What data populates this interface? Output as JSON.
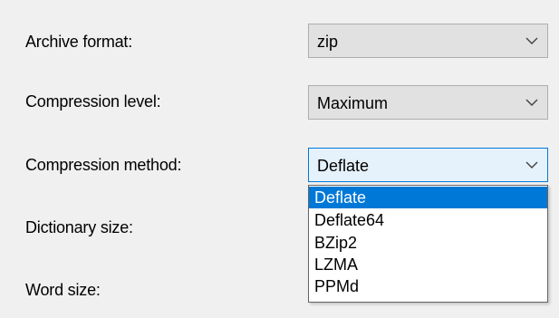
{
  "fields": [
    {
      "label": "Archive format:",
      "value": "zip"
    },
    {
      "label": "Compression level:",
      "value": "Maximum"
    },
    {
      "label": "Compression method:",
      "value": "Deflate"
    },
    {
      "label": "Dictionary size:"
    },
    {
      "label": "Word size:"
    }
  ],
  "dropdown": {
    "open_for": "Compression method",
    "selected": "Deflate",
    "options": [
      "Deflate",
      "Deflate64",
      "BZip2",
      "LZMA",
      "PPMd"
    ]
  },
  "icons": {
    "dropdown_arrow": "chevron-down-icon"
  },
  "colors": {
    "panel_bg": "#f0f0f0",
    "combo_bg": "#e1e1e1",
    "combo_border": "#adadad",
    "focus_border": "#0078d7",
    "focus_bg": "#e5f1fb",
    "selection_bg": "#0078d7",
    "selection_text": "#ffffff"
  }
}
